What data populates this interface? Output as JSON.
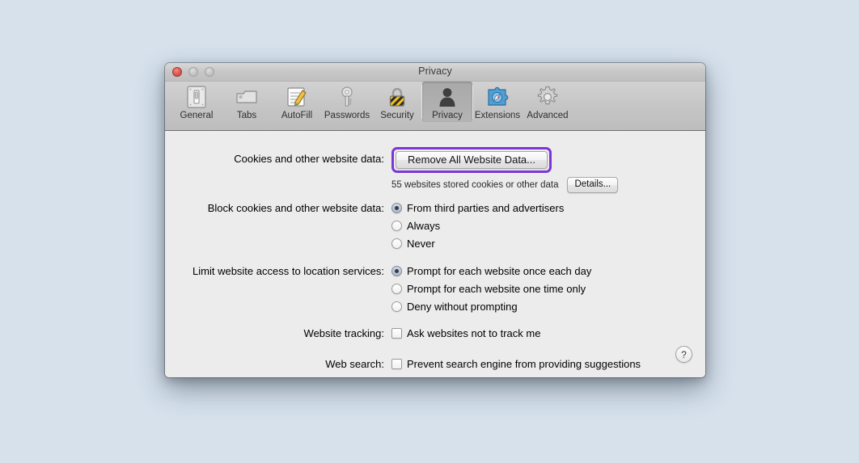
{
  "window": {
    "title": "Privacy",
    "traffic_lights": [
      {
        "name": "close",
        "color": "#e05f58"
      },
      {
        "name": "minimize",
        "color": "#c6c6c6"
      },
      {
        "name": "zoom",
        "color": "#c6c6c6"
      }
    ]
  },
  "toolbar": {
    "items": [
      {
        "label": "General",
        "icon": "switch-plate-icon",
        "selected": false
      },
      {
        "label": "Tabs",
        "icon": "tabs-icon",
        "selected": false
      },
      {
        "label": "AutoFill",
        "icon": "pencil-form-icon",
        "selected": false
      },
      {
        "label": "Passwords",
        "icon": "key-icon",
        "selected": false
      },
      {
        "label": "Security",
        "icon": "padlock-icon",
        "selected": false
      },
      {
        "label": "Privacy",
        "icon": "person-icon",
        "selected": true
      },
      {
        "label": "Extensions",
        "icon": "puzzle-piece-icon",
        "selected": false
      },
      {
        "label": "Advanced",
        "icon": "gear-icon",
        "selected": false
      }
    ]
  },
  "main": {
    "cookies": {
      "label": "Cookies and other website data:",
      "remove_button": "Remove All Website Data...",
      "remove_button_focused": true,
      "focus_ring_color": "#7a37d6",
      "status_text": "55 websites stored cookies or other data",
      "details_button": "Details..."
    },
    "block_cookies": {
      "label": "Block cookies and other website data:",
      "options": [
        {
          "label": "From third parties and advertisers",
          "selected": true
        },
        {
          "label": "Always",
          "selected": false
        },
        {
          "label": "Never",
          "selected": false
        }
      ]
    },
    "location_services": {
      "label": "Limit website access to location services:",
      "options": [
        {
          "label": "Prompt for each website once each day",
          "selected": true
        },
        {
          "label": "Prompt for each website one time only",
          "selected": false
        },
        {
          "label": "Deny without prompting",
          "selected": false
        }
      ]
    },
    "website_tracking": {
      "label": "Website tracking:",
      "checkbox_label": "Ask websites not to track me",
      "checked": false
    },
    "web_search": {
      "label": "Web search:",
      "checkbox_label": "Prevent search engine from providing suggestions",
      "checked": false
    },
    "help_button": "?"
  }
}
